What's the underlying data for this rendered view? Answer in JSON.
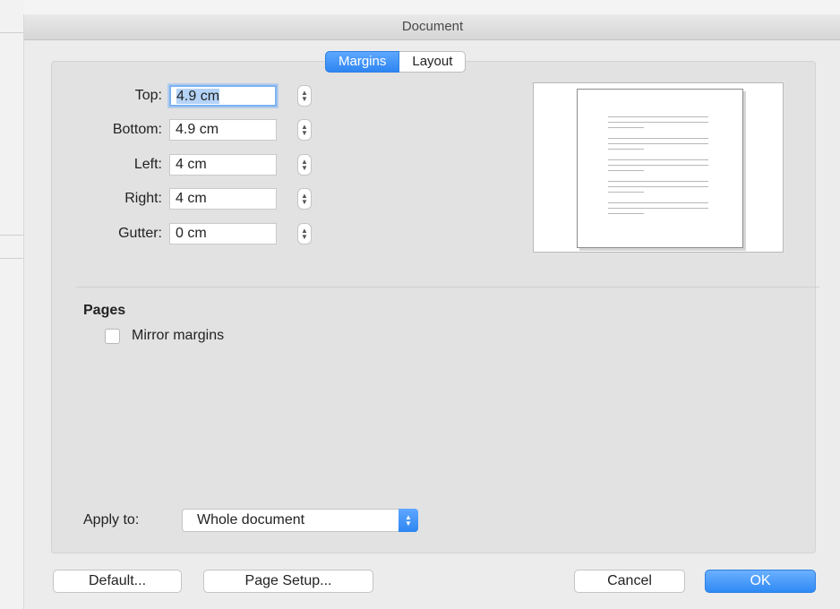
{
  "window": {
    "title": "Document"
  },
  "tabs": [
    "Margins",
    "Layout"
  ],
  "active_tab": "Margins",
  "margins": {
    "top": {
      "label": "Top:",
      "value": "4.9 cm"
    },
    "bottom": {
      "label": "Bottom:",
      "value": "4.9 cm"
    },
    "left": {
      "label": "Left:",
      "value": "4 cm"
    },
    "right": {
      "label": "Right:",
      "value": "4 cm"
    },
    "gutter": {
      "label": "Gutter:",
      "value": "0 cm"
    }
  },
  "pages": {
    "title": "Pages",
    "mirror_margins": {
      "label": "Mirror margins",
      "checked": false
    }
  },
  "apply_to": {
    "label": "Apply to:",
    "value": "Whole document"
  },
  "buttons": {
    "default": "Default...",
    "page_setup": "Page Setup...",
    "cancel": "Cancel",
    "ok": "OK"
  },
  "colors": {
    "accent": "#2e86f2",
    "panel": "#e2e2e2",
    "window": "#ececec"
  }
}
